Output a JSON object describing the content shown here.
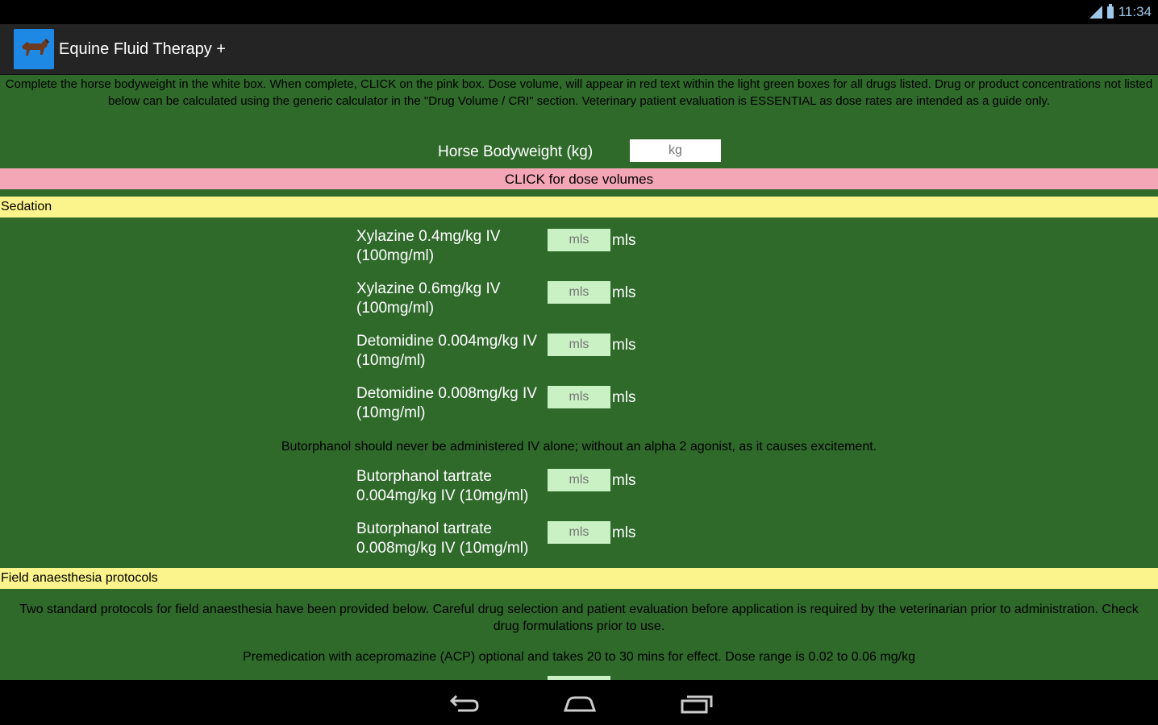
{
  "status": {
    "time": "11:34",
    "signal_icon": "signal-icon",
    "battery_icon": "battery-icon"
  },
  "app": {
    "title": "Equine Fluid Therapy +",
    "icon": "horse-icon"
  },
  "intro_text": "Complete the horse bodyweight in the white box. When complete, CLICK on the pink box. Dose volume, will appear in red text within the light green boxes for all drugs listed. Drug or product concentrations not listed below can be calculated using the generic calculator in the \"Drug Volume / CRI\" section. Veterinary patient evaluation is ESSENTIAL as dose rates are intended as a guide only.",
  "bodyweight": {
    "label": "Horse Bodyweight (kg)",
    "placeholder": "kg",
    "value": ""
  },
  "dose_button": "CLICK for dose volumes",
  "sections": {
    "sedation": "Sedation",
    "field": "Field anaesthesia protocols"
  },
  "drugs": [
    {
      "label": "Xylazine 0.4mg/kg IV (100mg/ml)",
      "placeholder": "mls",
      "unit": "mls"
    },
    {
      "label": "Xylazine 0.6mg/kg IV (100mg/ml)",
      "placeholder": "mls",
      "unit": "mls"
    },
    {
      "label": "Detomidine 0.004mg/kg IV (10mg/ml)",
      "placeholder": "mls",
      "unit": "mls"
    },
    {
      "label": "Detomidine 0.008mg/kg IV (10mg/ml)",
      "placeholder": "mls",
      "unit": "mls"
    },
    {
      "label": "Butorphanol tartrate 0.004mg/kg IV (10mg/ml)",
      "placeholder": "mls",
      "unit": "mls"
    },
    {
      "label": "Butorphanol tartrate 0.008mg/kg IV (10mg/ml)",
      "placeholder": "mls",
      "unit": "mls"
    }
  ],
  "butorphanol_note": "Butorphanol should never be administered IV alone; without an alpha 2 agonist, as it causes excitement.",
  "field_note": "Two standard protocols for field anaesthesia have been provided below. Careful drug selection and patient evaluation before application is required by the veterinarian prior to administration. Check drug formulations prior to use.",
  "premed_note": "Premedication with acepromazine (ACP) optional and takes 20 to 30 mins for effect. Dose range is 0.02 to 0.06 mg/kg",
  "nav": {
    "back_icon": "back-icon",
    "home_icon": "home-icon",
    "recents_icon": "recents-icon"
  },
  "colors": {
    "background": "#2f6a2b",
    "pink": "#f4a6b7",
    "yellow": "#fbf38b",
    "light_green": "#c9f1c4"
  }
}
